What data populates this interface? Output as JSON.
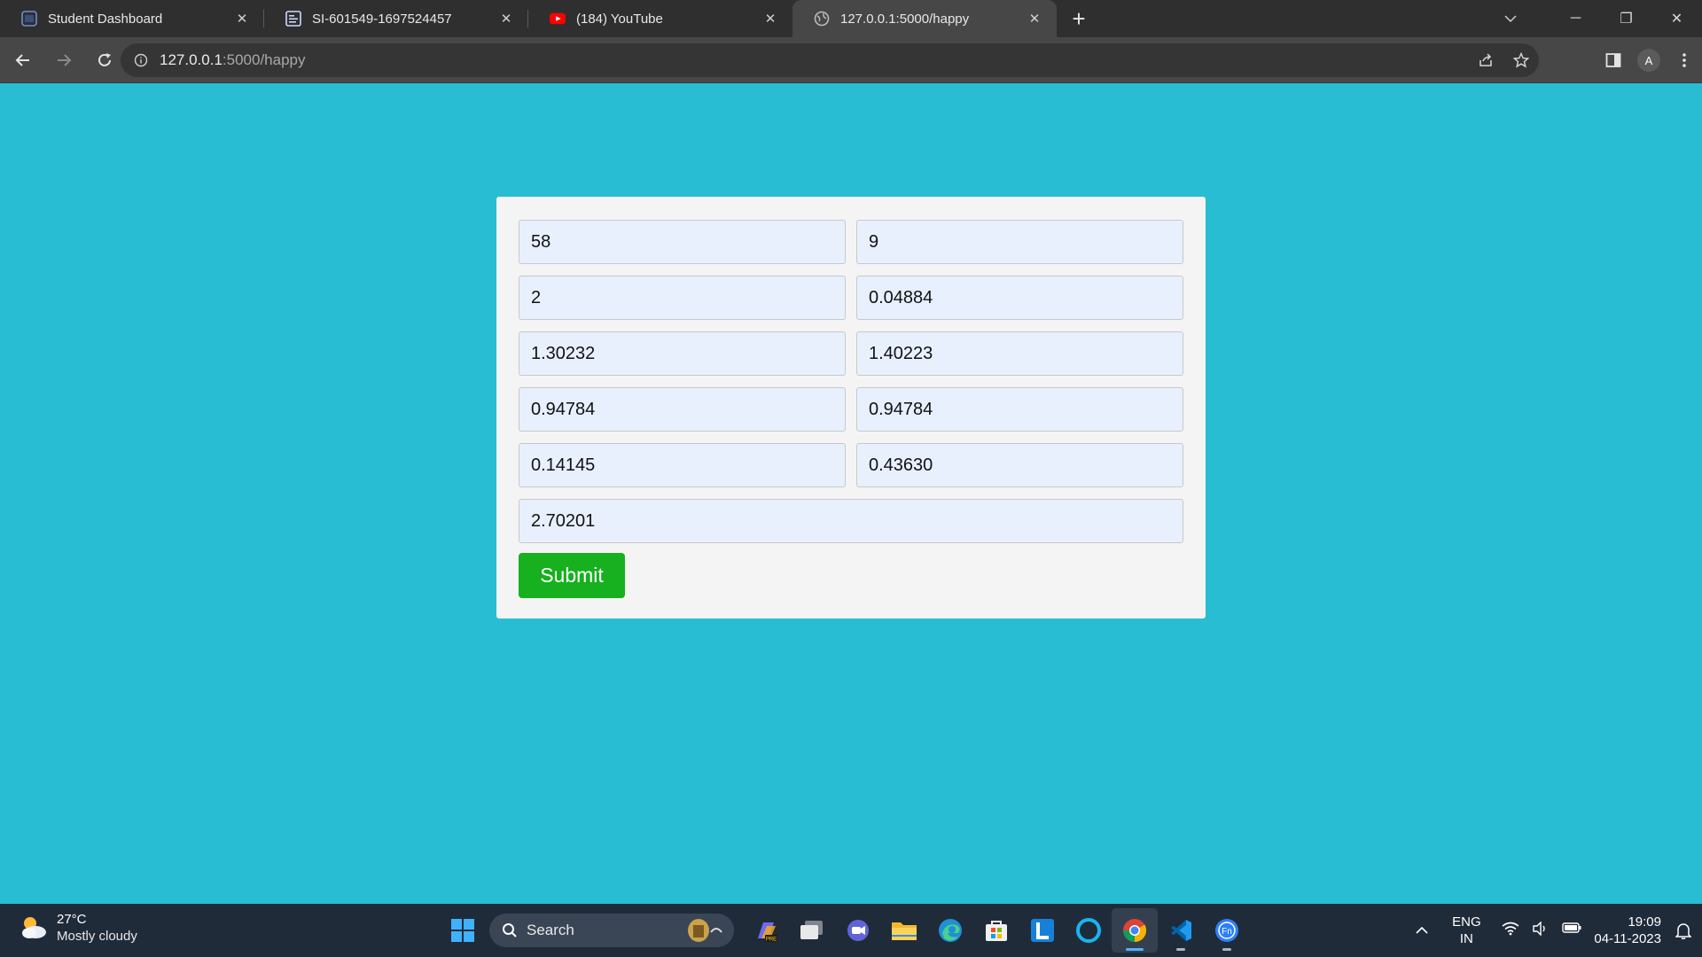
{
  "browser": {
    "tabs": [
      {
        "title": "Student Dashboard",
        "icon": "dashboard-icon"
      },
      {
        "title": "SI-601549-1697524457",
        "icon": "document-icon"
      },
      {
        "title": "(184) YouTube",
        "icon": "youtube-icon"
      },
      {
        "title": "127.0.0.1:5000/happy",
        "icon": "globe-icon",
        "active": true
      }
    ],
    "url_host": "127.0.0.1",
    "url_path": ":5000/happy",
    "profile_initial": "A"
  },
  "form": {
    "fields": [
      "58",
      "9",
      "2",
      "0.04884",
      "1.30232",
      "1.40223",
      "0.94784",
      "0.94784",
      "0.14145",
      "0.43630",
      "2.70201"
    ],
    "submit_label": "Submit",
    "submit_color": "#17b01f",
    "background_color": "#29bdd3"
  },
  "taskbar": {
    "weather_temp": "27°C",
    "weather_desc": "Mostly cloudy",
    "search_placeholder": "Search",
    "language_line1": "ENG",
    "language_line2": "IN",
    "time": "19:09",
    "date": "04-11-2023"
  }
}
